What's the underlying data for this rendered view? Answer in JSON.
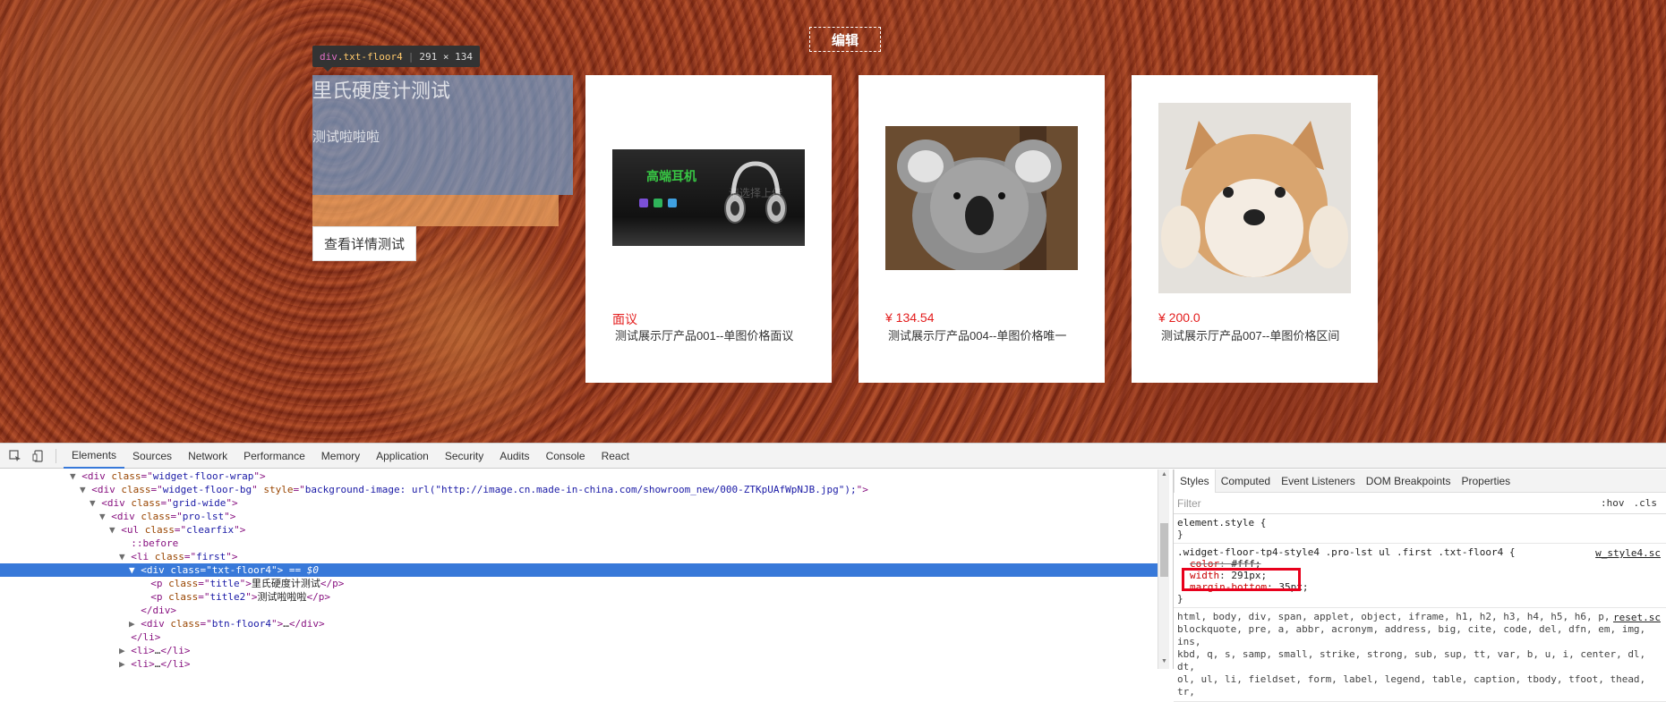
{
  "page": {
    "edit_label": "编辑",
    "inspect": {
      "tag": "div",
      "cls": ".txt-floor4",
      "size": "291 × 134"
    },
    "floor": {
      "title": "里氏硬度计测试",
      "subtitle": "测试啦啦啦",
      "detail_button": "查看详情测试"
    },
    "products": [
      {
        "price": "面议",
        "name": "测试展示厅产品001--单图价格面议",
        "image": "headphones",
        "image_title": "高端耳机",
        "image_watermark": "请选择上传"
      },
      {
        "price": "¥ 134.54",
        "name": "测试展示厅产品004--单图价格唯一",
        "image": "koala"
      },
      {
        "price": "¥ 200.0",
        "name": "测试展示厅产品007--单图价格区间",
        "image": "shiba-dog"
      }
    ],
    "colors": {
      "price": "#e31c1c",
      "highlight_content": "#6fa8dc",
      "highlight_margin": "#f6b26b"
    }
  },
  "devtools": {
    "tools": [
      "inspect-icon",
      "device-toggle-icon"
    ],
    "tabs": [
      "Elements",
      "Sources",
      "Network",
      "Performance",
      "Memory",
      "Application",
      "Security",
      "Audits",
      "Console",
      "React"
    ],
    "active_tab": "Elements",
    "dom": [
      {
        "indent": 6,
        "arrow": "▼",
        "open": "<div ",
        "attrs": [
          [
            "class",
            "widget-floor-wrap"
          ]
        ],
        "close": ">"
      },
      {
        "indent": 7,
        "arrow": "▼",
        "open": "<div ",
        "attrs": [
          [
            "class",
            "widget-floor-bg"
          ],
          [
            "style",
            "background-image: url(\"http://image.cn.made-in-china.com/showroom_new/000-ZTKpUAfWpNJB.jpg\");"
          ]
        ],
        "close": ">"
      },
      {
        "indent": 8,
        "arrow": "▼",
        "open": "<div ",
        "attrs": [
          [
            "class",
            "grid-wide"
          ]
        ],
        "close": ">"
      },
      {
        "indent": 9,
        "arrow": "▼",
        "open": "<div ",
        "attrs": [
          [
            "class",
            "pro-lst"
          ]
        ],
        "close": ">"
      },
      {
        "indent": 10,
        "arrow": "▼",
        "open": "<ul ",
        "attrs": [
          [
            "class",
            "clearfix"
          ]
        ],
        "close": ">"
      },
      {
        "indent": 11,
        "arrow": "",
        "pseudo": "::before"
      },
      {
        "indent": 11,
        "arrow": "▼",
        "open": "<li ",
        "attrs": [
          [
            "class",
            "first"
          ]
        ],
        "close": ">"
      },
      {
        "indent": 12,
        "arrow": "▼",
        "open": "<div ",
        "attrs": [
          [
            "class",
            "txt-floor4"
          ]
        ],
        "close": ">",
        "suffix": " == $0",
        "selected": true
      },
      {
        "indent": 13,
        "arrow": "",
        "open": "<p ",
        "attrs": [
          [
            "class",
            "title"
          ]
        ],
        "close": ">",
        "text": "里氏硬度计测试",
        "end": "</p>"
      },
      {
        "indent": 13,
        "arrow": "",
        "open": "<p ",
        "attrs": [
          [
            "class",
            "title2"
          ]
        ],
        "close": ">",
        "text": "测试啦啦啦",
        "end": "</p>"
      },
      {
        "indent": 12,
        "arrow": "",
        "open": "</div>",
        "attrs": [],
        "close": ""
      },
      {
        "indent": 12,
        "arrow": "▶",
        "open": "<div ",
        "attrs": [
          [
            "class",
            "btn-floor4"
          ]
        ],
        "close": ">",
        "text": "…",
        "end": "</div>"
      },
      {
        "indent": 11,
        "arrow": "",
        "open": "</li>",
        "attrs": [],
        "close": ""
      },
      {
        "indent": 11,
        "arrow": "▶",
        "open": "<li>",
        "attrs": [],
        "close": "",
        "text": "…",
        "end": "</li>"
      },
      {
        "indent": 11,
        "arrow": "▶",
        "open": "<li>",
        "attrs": [],
        "close": "",
        "text": "…",
        "end": "</li>"
      }
    ],
    "styles": {
      "tabs": [
        "Styles",
        "Computed",
        "Event Listeners",
        "DOM Breakpoints",
        "Properties"
      ],
      "active_tab": "Styles",
      "filter_placeholder": "Filter",
      "hov": ":hov",
      "cls": ".cls",
      "element_style": "element.style {",
      "rule_selector": ".widget-floor-tp4-style4 .pro-lst ul .first .txt-floor4 {",
      "rule_source": "w_style4.sc",
      "props": [
        {
          "name": "color",
          "value": "#fff;",
          "struck": true
        },
        {
          "name": "width",
          "value": "291px;"
        },
        {
          "name": "margin-bottom",
          "value": "35px;"
        }
      ],
      "brace_close": "}",
      "reset_source": "reset.sc",
      "reset_lines": [
        "html, body, div, span, applet, object, iframe, h1, h2, h3, h4, h5, h6, p,",
        "blockquote, pre, a, abbr, acronym, address, big, cite, code, del, dfn, em, img, ins,",
        "kbd, q, s, samp, small, strike, strong, sub, sup, tt, var, b, u, i, center, dl, dt,",
        "ol, ul, li, fieldset, form, label, legend, table, caption, tbody, tfoot, thead, tr,"
      ]
    }
  }
}
